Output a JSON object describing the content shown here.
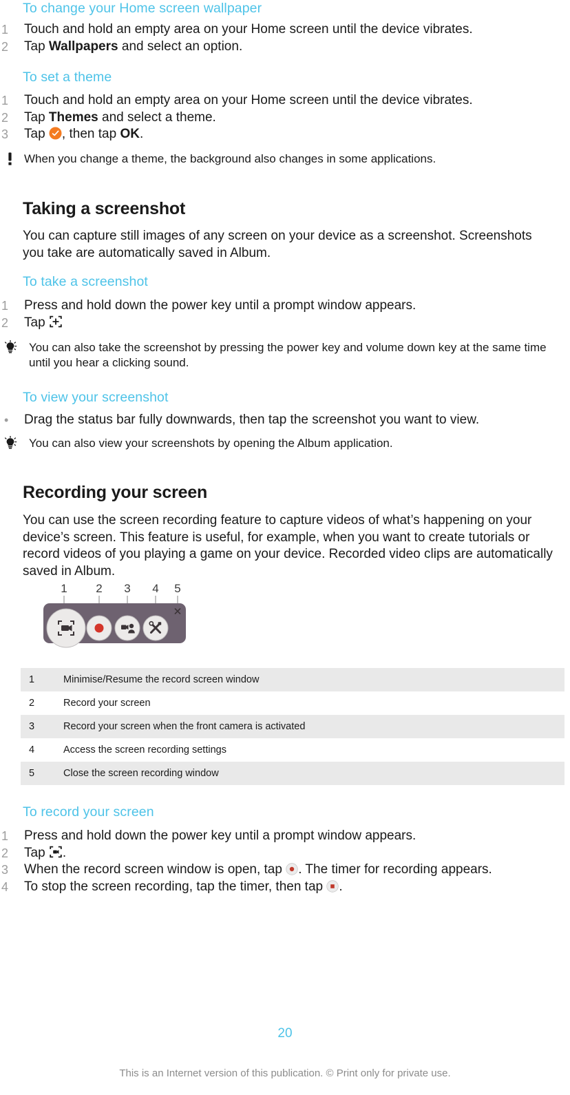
{
  "document": {
    "page_number": "20",
    "footer_note": "This is an Internet version of this publication. © Print only for private use."
  },
  "sections": {
    "wallpaper": {
      "heading": "To change your Home screen wallpaper",
      "steps": [
        {
          "num": "1",
          "text": "Touch and hold an empty area on your Home screen until the device vibrates."
        },
        {
          "num": "2",
          "pre": "Tap ",
          "bold": "Wallpapers",
          "post": " and select an option."
        }
      ]
    },
    "theme": {
      "heading": "To set a theme",
      "steps": [
        {
          "num": "1",
          "text": "Touch and hold an empty area on your Home screen until the device vibrates."
        },
        {
          "num": "2",
          "pre": "Tap ",
          "bold": "Themes",
          "post": " and select a theme."
        },
        {
          "num": "3",
          "pre": "Tap ",
          "icon": "orange-check-icon",
          "mid": ", then tap ",
          "bold": "OK",
          "post": "."
        }
      ],
      "note": {
        "icon": "exclamation-icon",
        "text": "When you change a theme, the background also changes in some applications."
      }
    },
    "screenshot": {
      "heading": "Taking a screenshot",
      "intro": "You can capture still images of any screen on your device as a screenshot. Screenshots you take are automatically saved in Album.",
      "take": {
        "heading": "To take a screenshot",
        "steps": [
          {
            "num": "1",
            "text": "Press and hold down the power key until a prompt window appears."
          },
          {
            "num": "2",
            "pre": "Tap ",
            "icon": "capture-frame-icon",
            "post": ""
          }
        ],
        "tip": {
          "icon": "lightbulb-icon",
          "text": "You can also take the screenshot by pressing the power key and volume down key at the same time until you hear a clicking sound."
        }
      },
      "view": {
        "heading": "To view your screenshot",
        "bullets": [
          {
            "bullet": "•",
            "text": "Drag the status bar fully downwards, then tap the screenshot you want to view."
          }
        ],
        "tip": {
          "icon": "lightbulb-icon",
          "text": "You can also view your screenshots by opening the Album application."
        }
      }
    },
    "recording": {
      "heading": "Recording your screen",
      "intro": "You can use the screen recording feature to capture videos of what’s happening on your device’s screen. This feature is useful, for example, when you want to create tutorials or record videos of you playing a game on your device. Recorded video clips are automatically saved in Album.",
      "figure": {
        "name": "screen-recording-widget-diagram",
        "callouts": [
          "1",
          "2",
          "3",
          "4",
          "5"
        ],
        "buttons": [
          {
            "label": "1",
            "icon": "minimise-resume-icon"
          },
          {
            "label": "2",
            "icon": "record-dot-icon"
          },
          {
            "label": "3",
            "icon": "front-camera-record-icon"
          },
          {
            "label": "4",
            "icon": "settings-wrench-icon"
          },
          {
            "label": "5",
            "icon": "close-x-icon"
          }
        ],
        "bar_color": "#6e6270",
        "button_color": "#eceaea",
        "record_dot_color": "#d4352a"
      },
      "table": {
        "rows": [
          {
            "num": "1",
            "desc": "Minimise/Resume the record screen window"
          },
          {
            "num": "2",
            "desc": "Record your screen"
          },
          {
            "num": "3",
            "desc": "Record your screen when the front camera is activated"
          },
          {
            "num": "4",
            "desc": "Access the screen recording settings"
          },
          {
            "num": "5",
            "desc": "Close the screen recording window"
          }
        ]
      },
      "record_steps": {
        "heading": "To record your screen",
        "steps": [
          {
            "num": "1",
            "text": "Press and hold down the power key until a prompt window appears."
          },
          {
            "num": "2",
            "pre": "Tap ",
            "icon": "record-frame-icon",
            "post": "."
          },
          {
            "num": "3",
            "pre": "When the record screen window is open, tap ",
            "icon": "record-dot-button-icon",
            "post": ". The timer for recording appears."
          },
          {
            "num": "4",
            "pre": "To stop the screen recording, tap the timer, then tap ",
            "icon": "stop-square-button-icon",
            "post": "."
          }
        ]
      }
    }
  },
  "colors": {
    "accent": "#4ec3e8",
    "text": "#1a1a1a",
    "muted": "#9d9d9d",
    "table_stripe": "#e9e9e9",
    "orange": "#f47b20",
    "record_red": "#d4352a",
    "footer_gray": "#8c8c8c"
  }
}
